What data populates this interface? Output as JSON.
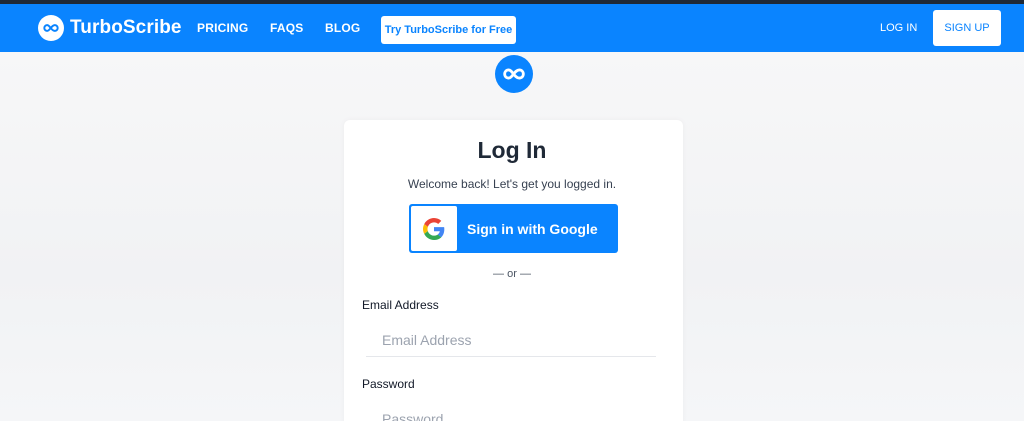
{
  "nav": {
    "brand": "TurboScribe",
    "links": [
      "PRICING",
      "FAQS",
      "BLOG"
    ],
    "try_button": "Try TurboScribe for Free",
    "login": "LOG IN",
    "signup": "SIGN UP"
  },
  "login": {
    "title": "Log In",
    "subtitle": "Welcome back! Let's get you logged in.",
    "google_button": "Sign in with Google",
    "separator": "— or —",
    "email_label": "Email Address",
    "email_placeholder": "Email Address",
    "email_value": "",
    "password_label": "Password",
    "password_placeholder": "Password",
    "password_value": ""
  },
  "colors": {
    "brand_blue": "#0a84ff",
    "white": "#ffffff",
    "page_bg": "#f3f4f6"
  },
  "icons": [
    "infinity-logo-icon",
    "google-g-icon"
  ]
}
